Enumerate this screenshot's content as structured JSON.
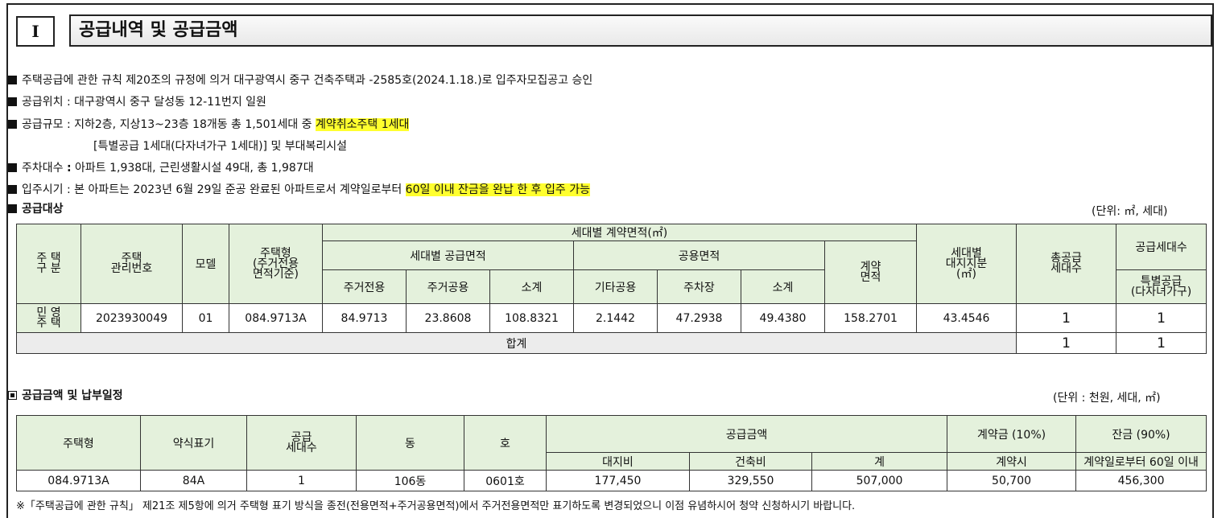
{
  "header": {
    "roman": "I",
    "title": "공급내역 및 공급금액"
  },
  "intro": {
    "l1": "주택공급에 관한 규칙 제20조의 규정에 의거 대구광역시 중구 건축주택과 -2585호(2024.1.18.)로 입주자모집공고 승인",
    "l2": "공급위치 : 대구광역시 중구 달성동 12-11번지 일원",
    "l3a": "공급규모 : 지하2층, 지상13~23층 18개동 총 1,501세대 중 ",
    "l3b": "계약취소주택 1세대",
    "l4": "[특별공급 1세대(다자녀가구 1세대)] 및 부대복리시설",
    "l5a": "주차대수 ",
    "l5b": ":",
    "l5c": " 아파트 1,938대, 근린생활시설 49대, 총 1,987대",
    "l6a": "입주시기 : 본 아파트는 2023년 6월 29일 준공 완료된 아파트로서 계약일로부터 ",
    "l6b": "60일 이내 잔금을 완납 한 후 입주 가능"
  },
  "supply_target": {
    "title": "공급대상",
    "unit": "(단위: ㎡, 세대)",
    "h": {
      "housing_type_1": "주 택",
      "housing_type_2": "구 분",
      "mgmt_no": "주택\n관리번호",
      "model": "모델",
      "house_type": "주택형\n(주거전용\n면적기준)",
      "contract_area_group": "세대별 계약면적(㎡)",
      "supply_area": "세대별 공급면적",
      "common_area": "공용면적",
      "contract_area": "계약\n면적",
      "land_share": "세대별\n대지지분\n(㎡)",
      "total_units": "총공급\n세대수",
      "supply_units": "공급세대수",
      "exclusive": "주거전용",
      "residential_common": "주거공용",
      "subtotal1": "소계",
      "other_common": "기타공용",
      "parking": "주차장",
      "subtotal2": "소계",
      "special": "특별공급\n(다자녀가구)"
    },
    "row": {
      "type": "민 영\n주 택",
      "mgmt_no": "2023930049",
      "model": "01",
      "house_type": "084.9713A",
      "exclusive": "84.9713",
      "residential_common": "23.8608",
      "subtotal1": "108.8321",
      "other_common": "2.1442",
      "parking": "47.2938",
      "subtotal2": "49.4380",
      "contract_area": "158.2701",
      "land_share": "43.4546",
      "total_units": "1",
      "special": "1"
    },
    "total": {
      "label": "합계",
      "total_units": "1",
      "special": "1"
    }
  },
  "price": {
    "title": "공급금액 및 납부일정",
    "unit": "(단위 : 천원, 세대, ㎡)",
    "h": {
      "house_type": "주택형",
      "short": "약식표기",
      "units": "공급\n세대수",
      "dong": "동",
      "ho": "호",
      "amount": "공급금액",
      "deposit": "계약금 (10%)",
      "balance": "잔금 (90%)",
      "land": "대지비",
      "build": "건축비",
      "sum": "계",
      "at_contract": "계약시",
      "within_60": "계약일로부터 60일 이내"
    },
    "row": {
      "house_type": "084.9713A",
      "short": "84A",
      "units": "1",
      "dong": "106동",
      "ho": "0601호",
      "land": "177,450",
      "build": "329,550",
      "sum": "507,000",
      "deposit": "50,700",
      "balance": "456,300"
    },
    "note": "※「주택공급에 관한 규칙」 제21조 제5항에 의거 주택형 표기 방식을 종전(전용면적+주거공용면적)에서 주거전용면적만 표기하도록 변경되었으니 이점 유념하시어 청약 신청하시기 바랍니다."
  }
}
